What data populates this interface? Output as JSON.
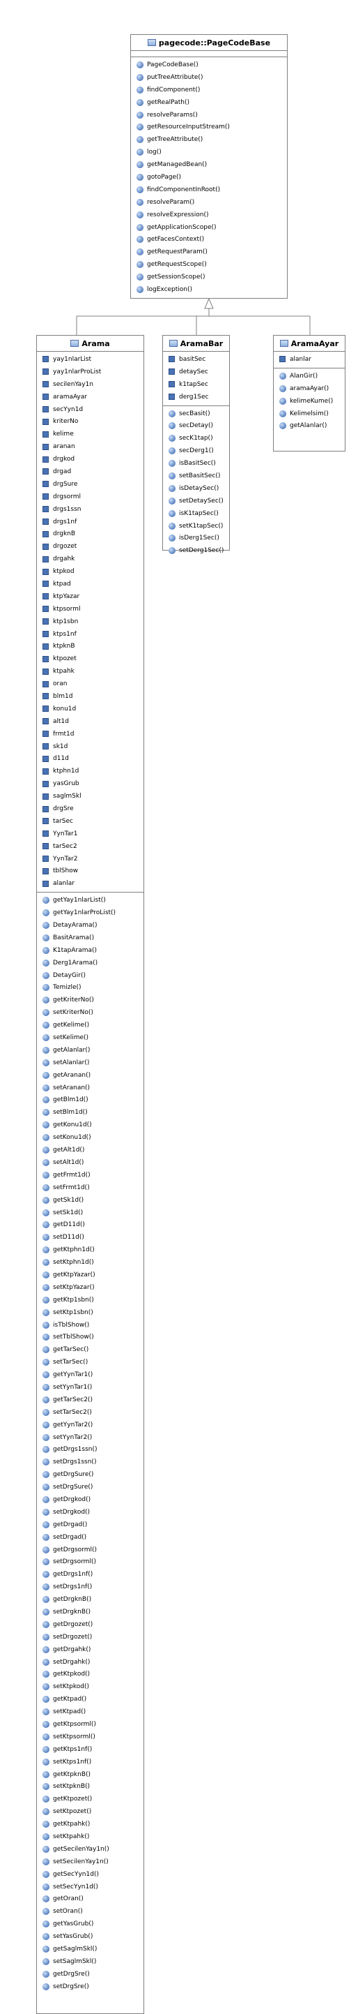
{
  "base": {
    "title": "pagecode::PageCodeBase",
    "methods": [
      "PageCodeBase()",
      "putTreeAttribute()",
      "findComponent()",
      "getRealPath()",
      "resolveParams()",
      "getResourceInputStream()",
      "getTreeAttribute()",
      "log()",
      "getManagedBean()",
      "gotoPage()",
      "findComponentInRoot()",
      "resolveParam()",
      "resolveExpression()",
      "getApplicationScope()",
      "getFacesContext()",
      "getRequestParam()",
      "getRequestScope()",
      "getSessionScope()",
      "logException()"
    ]
  },
  "arama": {
    "title": "Arama",
    "fields": [
      "yay1nlarList",
      "yay1nlarProList",
      "secilenYay1n",
      "aramaAyar",
      "secYyn1d",
      "kriterNo",
      "kelime",
      "aranan",
      "drgkod",
      "drgad",
      "drgSure",
      "drgsorml",
      "drgs1ssn",
      "drgs1nf",
      "drgknB",
      "drgozet",
      "drgahk",
      "ktpkod",
      "ktpad",
      "ktpYazar",
      "ktpsorml",
      "ktp1sbn",
      "ktps1nf",
      "ktpknB",
      "ktpozet",
      "ktpahk",
      "oran",
      "blm1d",
      "konu1d",
      "alt1d",
      "frmt1d",
      "sk1d",
      "d11d",
      "ktphn1d",
      "yasGrub",
      "saglmSkl",
      "drgSre",
      "tarSec",
      "YynTar1",
      "tarSec2",
      "YynTar2",
      "tblShow",
      "alanlar"
    ],
    "methods": [
      "getYay1nlarList()",
      "getYay1nlarProList()",
      "DetayArama()",
      "BasitArama()",
      "K1tapArama()",
      "Derg1Arama()",
      "DetayGir()",
      "Temizle()",
      "getKriterNo()",
      "setKriterNo()",
      "getKelime()",
      "setKelime()",
      "getAlanlar()",
      "setAlanlar()",
      "getAranan()",
      "setAranan()",
      "getBlm1d()",
      "setBlm1d()",
      "getKonu1d()",
      "setKonu1d()",
      "getAlt1d()",
      "setAlt1d()",
      "getFrmt1d()",
      "setFrmt1d()",
      "getSk1d()",
      "setSk1d()",
      "getD11d()",
      "setD11d()",
      "getKtphn1d()",
      "setKtphn1d()",
      "getKtpYazar()",
      "setKtpYazar()",
      "getKtp1sbn()",
      "setKtp1sbn()",
      "isTblShow()",
      "setTblShow()",
      "getTarSec()",
      "setTarSec()",
      "getYynTar1()",
      "setYynTar1()",
      "getTarSec2()",
      "setTarSec2()",
      "getYynTar2()",
      "setYynTar2()",
      "getDrgs1ssn()",
      "setDrgs1ssn()",
      "getDrgSure()",
      "setDrgSure()",
      "getDrgkod()",
      "setDrgkod()",
      "getDrgad()",
      "setDrgad()",
      "getDrgsorml()",
      "setDrgsorml()",
      "getDrgs1nf()",
      "setDrgs1nf()",
      "getDrgknB()",
      "setDrgknB()",
      "getDrgozet()",
      "setDrgozet()",
      "getDrgahk()",
      "setDrgahk()",
      "getKtpkod()",
      "setKtpkod()",
      "getKtpad()",
      "setKtpad()",
      "getKtpsorml()",
      "setKtpsorml()",
      "getKtps1nf()",
      "setKtps1nf()",
      "getKtpknB()",
      "setKtpknB()",
      "getKtpozet()",
      "setKtpozet()",
      "getKtpahk()",
      "setKtpahk()",
      "getSecilenYay1n()",
      "setSecilenYay1n()",
      "getSecYyn1d()",
      "setSecYyn1d()",
      "getOran()",
      "setOran()",
      "getYasGrub()",
      "setYasGrub()",
      "getSaglmSkl()",
      "setSaglmSkl()",
      "getDrgSre()",
      "setDrgSre()"
    ]
  },
  "aramaBar": {
    "title": "AramaBar",
    "fields": [
      "basitSec",
      "detaySec",
      "k1tapSec",
      "derg1Sec"
    ],
    "methods": [
      "secBasit()",
      "secDetay()",
      "secK1tap()",
      "secDerg1()",
      "isBasitSec()",
      "setBasitSec()",
      "isDetaySec()",
      "setDetaySec()",
      "isK1tapSec()",
      "setK1tapSec()",
      "isDerg1Sec()",
      "setDerg1Sec()"
    ]
  },
  "aramaAyar": {
    "title": "AramaAyar",
    "fields": [
      "alanlar"
    ],
    "methods": [
      "AlanGir()",
      "aramaAyar()",
      "kelimeKume()",
      "Kelimelsim()",
      "getAlanlar()"
    ]
  }
}
